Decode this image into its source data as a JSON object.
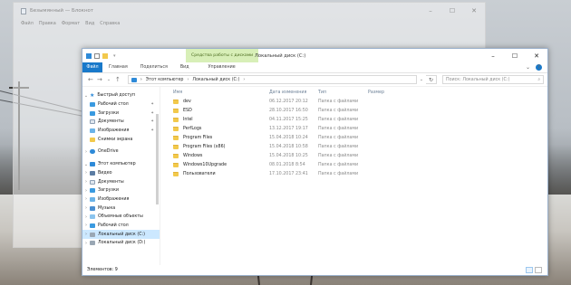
{
  "notepad": {
    "title": "Безымянный — Блокнот",
    "menu": [
      "Файл",
      "Правка",
      "Формат",
      "Вид",
      "Справка"
    ]
  },
  "explorer": {
    "title": "Локальный диск (C:)",
    "contextual_tab": "Средства работы с дисками",
    "ribbon_tabs": [
      "Файл",
      "Главная",
      "Поделиться",
      "Вид",
      "Управление"
    ],
    "address": {
      "segments": [
        "Этот компьютер",
        "Локальный диск (C:)"
      ]
    },
    "search": {
      "placeholder": "Поиск: Локальный диск (C:)"
    },
    "columns": {
      "name": "Имя",
      "date": "Дата изменения",
      "type": "Тип",
      "size": "Размер"
    },
    "files": [
      {
        "name": "dev",
        "date": "06.12.2017 20:12",
        "type": "Папка с файлами"
      },
      {
        "name": "ESD",
        "date": "28.10.2017 16:50",
        "type": "Папка с файлами"
      },
      {
        "name": "Intel",
        "date": "04.11.2017 15:25",
        "type": "Папка с файлами"
      },
      {
        "name": "PerfLogs",
        "date": "13.12.2017 19:17",
        "type": "Папка с файлами"
      },
      {
        "name": "Program Files",
        "date": "15.04.2018 10:24",
        "type": "Папка с файлами"
      },
      {
        "name": "Program Files (x86)",
        "date": "15.04.2018 10:58",
        "type": "Папка с файлами"
      },
      {
        "name": "Windows",
        "date": "15.04.2018 10:25",
        "type": "Папка с файлами"
      },
      {
        "name": "Windows10Upgrade",
        "date": "08.01.2018 8:54",
        "type": "Папка с файлами"
      },
      {
        "name": "Пользователи",
        "date": "17.10.2017 23:41",
        "type": "Папка с файлами"
      }
    ],
    "nav": {
      "quick_access": "Быстрый доступ",
      "quick_items": [
        "Рабочий стол",
        "Загрузки",
        "Документы",
        "Изображения",
        "Снимки экрана"
      ],
      "onedrive": "OneDrive",
      "this_pc": "Этот компьютер",
      "pc_items": [
        "Видео",
        "Документы",
        "Загрузки",
        "Изображения",
        "Музыка",
        "Объемные объекты",
        "Рабочий стол",
        "Локальный диск (C:)",
        "Локальный диск (D:)"
      ]
    },
    "status": "Элементов: 9"
  },
  "colors": {
    "accent": "#1979ca",
    "selection": "#cce8ff",
    "contextual_tab": "#d8efb8",
    "folder": "#f2c94c"
  }
}
